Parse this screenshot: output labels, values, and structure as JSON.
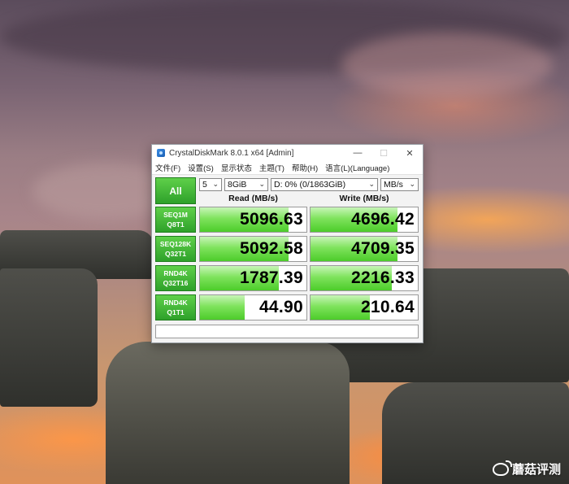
{
  "window": {
    "title": "CrystalDiskMark 8.0.1 x64 [Admin]",
    "controls": {
      "minimize": "—",
      "maximize": "☐",
      "close": "✕"
    }
  },
  "menu": [
    "文件(F)",
    "设置(S)",
    "显示状态",
    "主题(T)",
    "帮助(H)",
    "语言(L)(Language)"
  ],
  "controls": {
    "all_label": "All",
    "count": "5",
    "size": "8GiB",
    "drive": "D: 0% (0/1863GiB)",
    "unit": "MB/s"
  },
  "headers": {
    "read": "Read (MB/s)",
    "write": "Write (MB/s)"
  },
  "rows": [
    {
      "line1": "SEQ1M",
      "line2": "Q8T1",
      "read": "5096.63",
      "write": "4696.42",
      "read_fill": 0.83,
      "write_fill": 0.81
    },
    {
      "line1": "SEQ128K",
      "line2": "Q32T1",
      "read": "5092.58",
      "write": "4709.35",
      "read_fill": 0.83,
      "write_fill": 0.81
    },
    {
      "line1": "RND4K",
      "line2": "Q32T16",
      "read": "1787.39",
      "write": "2216.33",
      "read_fill": 0.74,
      "write_fill": 0.76
    },
    {
      "line1": "RND4K",
      "line2": "Q1T1",
      "read": "44.90",
      "write": "210.64",
      "read_fill": 0.42,
      "write_fill": 0.55
    }
  ],
  "status_text": "",
  "watermark": {
    "text": "蘑菇评测",
    "icon": "weibo-icon"
  }
}
